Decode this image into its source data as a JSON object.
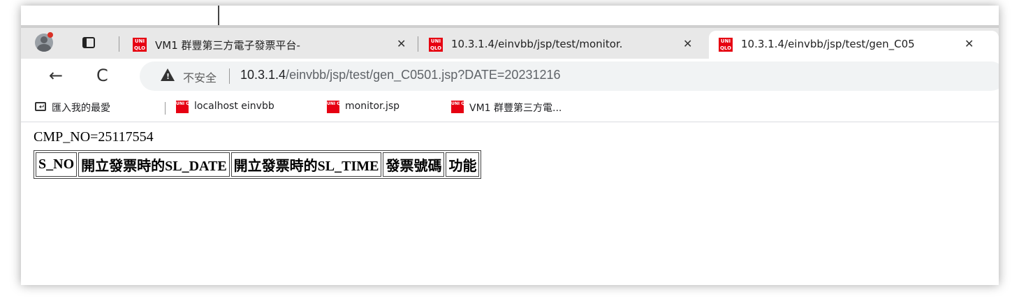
{
  "browser": {
    "tabs": [
      {
        "title": "VM1 群豐第三方電子發票平台-",
        "close_glyph": "✕",
        "active": false
      },
      {
        "title": "10.3.1.4/einvbb/jsp/test/monitor.",
        "close_glyph": "✕",
        "active": false
      },
      {
        "title": "10.3.1.4/einvbb/jsp/test/gen_C05",
        "close_glyph": "✕",
        "active": true
      }
    ],
    "favicon_text": "UNI QLO",
    "nav": {
      "back_glyph": "←",
      "reload_glyph": "C"
    },
    "address": {
      "security_label": "不安全",
      "url_host": "10.3.1.4",
      "url_path": "/einvbb/jsp/test/gen_C0501.jsp?DATE=20231216"
    },
    "bookmarks": {
      "import_label": "匯入我的最愛",
      "items": [
        "localhost einvbb",
        "monitor.jsp",
        "VM1 群豐第三方電..."
      ]
    },
    "icons": [
      "profile-icon",
      "tab-actions-icon",
      "uniqlo-favicon",
      "back-icon",
      "reload-icon",
      "warning-icon",
      "bookmark-folder-icon"
    ],
    "colors": {
      "favicon": "#e60012",
      "tabbar": "#e8e8e8",
      "omnibox": "#f1f3f4"
    }
  },
  "page": {
    "cmp_line": "CMP_NO=25117554",
    "table_headers": [
      "S_NO",
      "開立發票時的SL_DATE",
      "開立發票時的SL_TIME",
      "發票號碼",
      "功能"
    ]
  }
}
